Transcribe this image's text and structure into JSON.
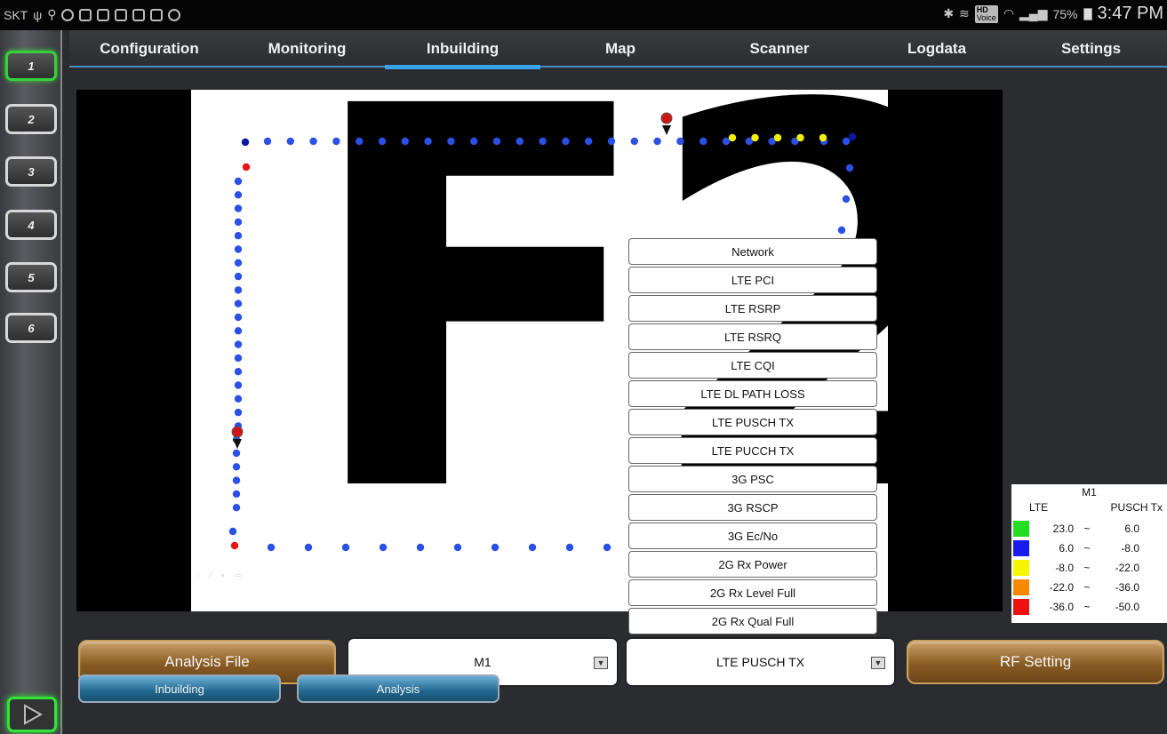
{
  "statusbar": {
    "carrier": "SKT",
    "battery": "75%",
    "time": "3:47 PM",
    "hd_label": "HD",
    "voice_label": "Voice"
  },
  "tabs": [
    {
      "label": "Configuration"
    },
    {
      "label": "Monitoring"
    },
    {
      "label": "Inbuilding"
    },
    {
      "label": "Map"
    },
    {
      "label": "Scanner"
    },
    {
      "label": "Logdata"
    },
    {
      "label": "Settings"
    }
  ],
  "active_tab": "Inbuilding",
  "sidebar": {
    "buttons": [
      "1",
      "2",
      "3",
      "4",
      "5",
      "6"
    ],
    "active": "1"
  },
  "floorplan": {
    "label": "F2"
  },
  "menu": {
    "items": [
      "Network",
      "LTE PCI",
      "LTE RSRP",
      "LTE RSRQ",
      "LTE CQI",
      "LTE DL PATH LOSS",
      "LTE PUSCH TX",
      "LTE PUCCH TX",
      "3G PSC",
      "3G RSCP",
      "3G Ec/No",
      "2G Rx Power",
      "2G Rx Level Full",
      "2G Rx Qual Full"
    ]
  },
  "legend": {
    "title": "M1",
    "col1": "LTE",
    "col2": "PUSCH Tx",
    "sep": "~",
    "rows": [
      {
        "color": "#22dd22",
        "from": "23.0",
        "to": "6.0"
      },
      {
        "color": "#1a1aee",
        "from": "6.0",
        "to": "-8.0"
      },
      {
        "color": "#f5f500",
        "from": "-8.0",
        "to": "-22.0"
      },
      {
        "color": "#f58a00",
        "from": "-22.0",
        "to": "-36.0"
      },
      {
        "color": "#ee1111",
        "from": "-36.0",
        "to": "-50.0"
      }
    ]
  },
  "controls": {
    "analysis_file": "Analysis File",
    "device_select": "M1",
    "metric_select": "LTE PUSCH TX",
    "rf_setting": "RF Setting",
    "inbuilding": "Inbuilding",
    "analysis": "Analysis"
  },
  "colors": {
    "accent": "#3aa3e6",
    "active_green": "#36d13a",
    "point_blue": "#2b50e6",
    "point_yellow": "#f2f200",
    "point_red": "#e11",
    "point_navy": "#0a1aa0"
  }
}
